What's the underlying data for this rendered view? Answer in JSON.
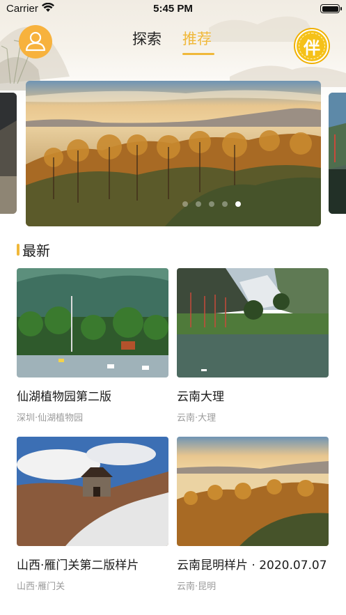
{
  "status_bar": {
    "carrier": "Carrier",
    "time": "5:45 PM"
  },
  "nav": {
    "tabs": [
      {
        "label": "探索",
        "active": false
      },
      {
        "label": "推荐",
        "active": true
      }
    ],
    "companion_label": "伴",
    "accent_color": "#f0b83a"
  },
  "banner": {
    "slide_count": 5,
    "active_slide": 5,
    "icons": [
      "avatar-icon",
      "companion-icon"
    ]
  },
  "section": {
    "title": "最新"
  },
  "cards": [
    {
      "title": "仙湖植物园第二版",
      "subtitle": "深圳·仙湖植物园"
    },
    {
      "title": "云南大理",
      "subtitle": "云南·大理"
    },
    {
      "title": "山西·雁门关第二版样片",
      "subtitle": "山西·雁门关"
    },
    {
      "title": "云南昆明样片 · 2020.07.07",
      "subtitle": "云南·昆明"
    }
  ]
}
